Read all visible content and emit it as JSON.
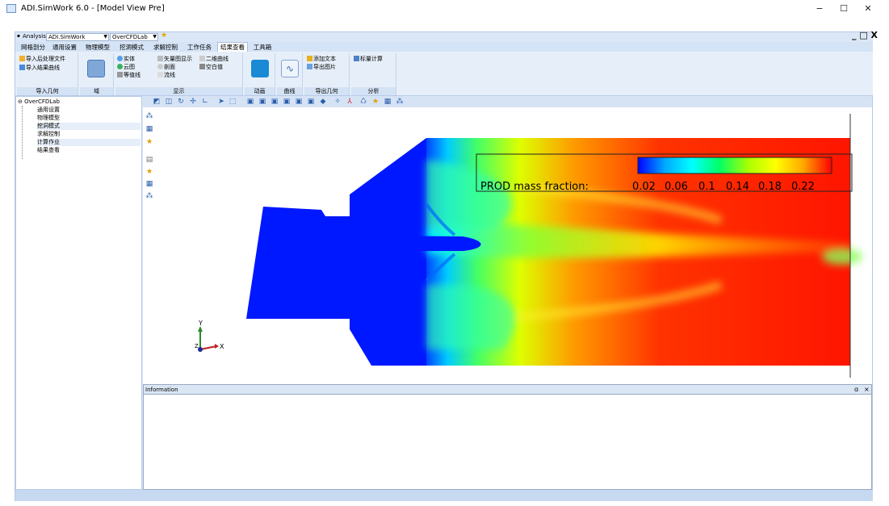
{
  "window": {
    "title": "ADI.SimWork 6.0 - [Model View Pre]",
    "minimize": "−",
    "maximize": "☐",
    "close": "✕",
    "inner_controls": "_ □ X"
  },
  "quick_access": {
    "analysis_label": "Analysis:",
    "analysis_value": "ADI.SimWork",
    "module_value": "OverCFDLab"
  },
  "tabs": [
    "网格剖分",
    "通用设置",
    "物理模型",
    "挖洞模式",
    "求解控制",
    "工作任务",
    "结果查看",
    "工具箱"
  ],
  "active_tab": "结果查看",
  "ribbon": {
    "import_geometry": {
      "caption": "导入几何",
      "import_post_file": "导入后处理文件",
      "import_result_curve": "导入结果曲线"
    },
    "domain": {
      "caption": "域"
    },
    "display": {
      "caption": "显示",
      "solid": "实体",
      "contour": "云图",
      "isoline": "等值线",
      "vector": "矢量图显示",
      "section": "剖面",
      "streamline": "流线",
      "curve2d": "二维曲线",
      "blank_value": "空白值"
    },
    "animation": {
      "caption": "动画"
    },
    "curve": {
      "caption": "曲线"
    },
    "export_geometry": {
      "caption": "导出几何",
      "add_text": "添加文本",
      "export_image": "导出图片"
    },
    "analysis": {
      "caption": "分析",
      "flux_calc": "标量计算"
    }
  },
  "tree": {
    "root": "OverCFDLab",
    "children": [
      "通用设置",
      "物理模型",
      "挖洞模式",
      "求解控制",
      "计算作业",
      "结果查看"
    ]
  },
  "viewport": {
    "legend_title": "PROD mass fraction:",
    "legend_ticks": [
      "0.02",
      "0.06",
      "0.1",
      "0.14",
      "0.18",
      "0.22"
    ],
    "legend_colors": [
      "#0000ff",
      "#00aaff",
      "#00ffff",
      "#00ff66",
      "#aaff00",
      "#ffff00",
      "#ffaa00",
      "#ff0000"
    ],
    "axis_y": "Y",
    "axis_x": "X",
    "axis_z": "Z"
  },
  "info_panel": {
    "title": "Information",
    "pin": "ɑ",
    "close": "×"
  }
}
